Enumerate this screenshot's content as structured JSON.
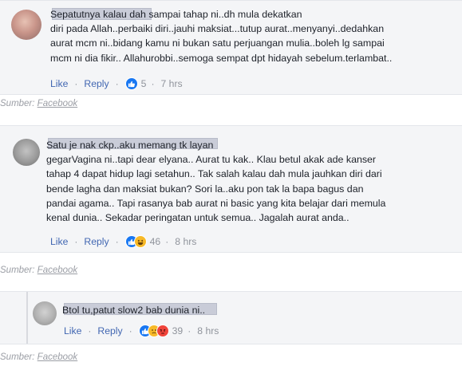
{
  "comments": [
    {
      "text": "Sepatutnya kalau dah sampai tahap ni..dh mula dekatkan\ndiri pada Allah..perbaiki diri..jauhi maksiat...tutup aurat..menyanyi..dedahkan\naurat mcm ni..bidang kamu ni bukan satu perjuangan mulia..boleh lg sampai\nmcm ni dia fikir.. Allahurobbi..semoga sempat dpt hidayah sebelum.terlambat..",
      "like_label": "Like",
      "reply_label": "Reply",
      "reaction_count": "5",
      "time": "7 hrs",
      "reactions": [
        "like-icon"
      ]
    },
    {
      "text": "Satu je nak ckp..aku memang tk layan\ngegarVagina ni..tapi dear elyana.. Aurat tu kak.. Klau betul akak ade kanser\ntahap 4 dapat hidup lagi setahun.. Tak salah kalau dah mula jauhkan diri dari\nbende lagha dan maksiat bukan? Sori la..aku pon tak la bapa bagus dan\npandai agama.. Tapi rasanya bab aurat ni basic yang kita belajar dari memula\nkenal dunia.. Sekadar peringatan untuk semua.. Jagalah aurat anda..",
      "like_label": "Like",
      "reply_label": "Reply",
      "reaction_count": "46",
      "time": "8 hrs",
      "reactions": [
        "like-icon",
        "haha-icon"
      ]
    },
    {
      "text": "Btol tu,patut slow2 bab dunia ni..",
      "like_label": "Like",
      "reply_label": "Reply",
      "reaction_count": "39",
      "time": "8 hrs",
      "reactions": [
        "like-icon",
        "sad-icon",
        "angry-icon"
      ]
    }
  ],
  "source_prefix": "Sumber:",
  "source_link": "Facebook",
  "separator": "·",
  "colors": {
    "link": "#4267b2",
    "meta": "#90949c",
    "like": "#1877f2",
    "haha": "#f7b928",
    "angry": "#f0443b"
  }
}
